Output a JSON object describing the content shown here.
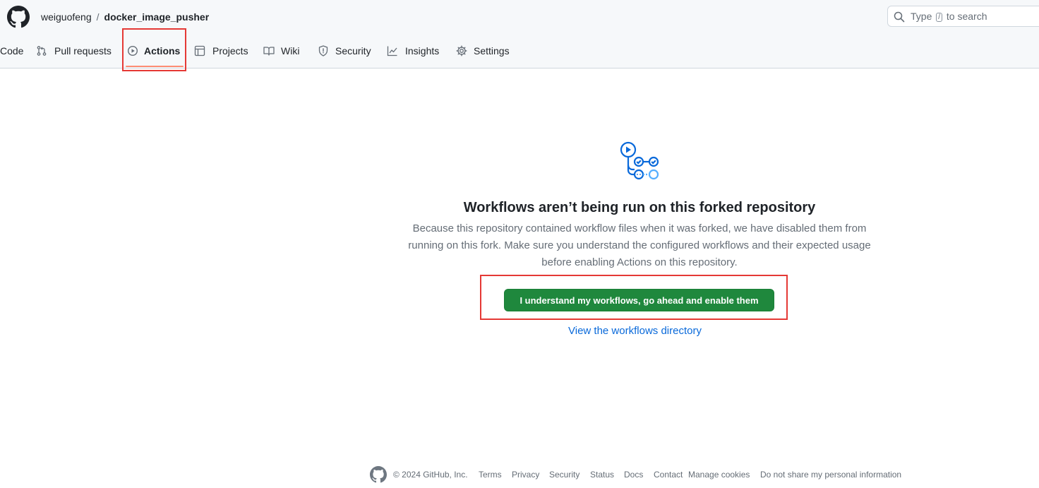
{
  "header": {
    "owner": "weiguofeng",
    "separator": "/",
    "repo": "docker_image_pusher",
    "search": {
      "prefix": "Type",
      "key": "/",
      "suffix": "to search"
    }
  },
  "tabs": [
    {
      "label": "Code",
      "icon": "code-icon"
    },
    {
      "label": "Pull requests",
      "icon": "pull-request-icon"
    },
    {
      "label": "Actions",
      "icon": "play-icon",
      "active": true
    },
    {
      "label": "Projects",
      "icon": "table-icon"
    },
    {
      "label": "Wiki",
      "icon": "book-icon"
    },
    {
      "label": "Security",
      "icon": "shield-icon"
    },
    {
      "label": "Insights",
      "icon": "graph-icon"
    },
    {
      "label": "Settings",
      "icon": "gear-icon"
    }
  ],
  "main": {
    "title": "Workflows aren’t being run on this forked repository",
    "description": "Because this repository contained workflow files when it was forked, we have disabled them from running on this fork. Make sure you understand the configured workflows and their expected usage before enabling Actions on this repository.",
    "enable_button": "I understand my workflows, go ahead and enable them",
    "view_link": "View the workflows directory"
  },
  "footer": {
    "copyright": "© 2024 GitHub, Inc.",
    "links": [
      "Terms",
      "Privacy",
      "Security",
      "Status",
      "Docs",
      "Contact",
      "Manage cookies",
      "Do not share my personal information"
    ]
  },
  "colors": {
    "accent_green": "#1f883d",
    "link_blue": "#0969da",
    "tab_underline": "#fd8c73",
    "highlight_red": "#e53935",
    "muted_text": "#656d76"
  }
}
